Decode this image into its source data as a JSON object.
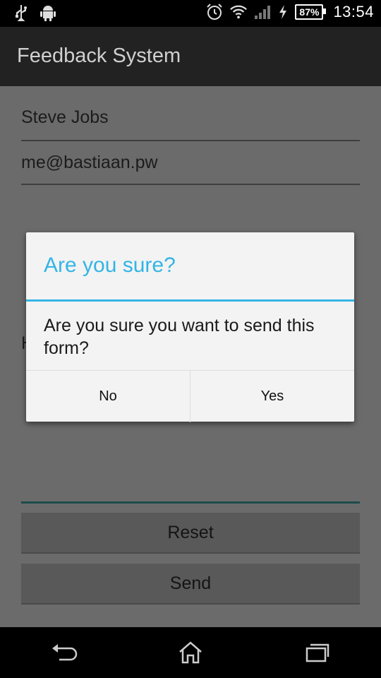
{
  "status_bar": {
    "icons": [
      "usb-icon",
      "android-icon",
      "alarm-icon",
      "wifi-icon",
      "signal-icon",
      "charging-icon",
      "battery-icon"
    ],
    "battery": "87%",
    "time": "13:54"
  },
  "app": {
    "title": "Feedback System"
  },
  "form": {
    "name_value": "Steve Jobs",
    "email_value": "me@bastiaan.pw",
    "partial_hint": "H",
    "reset_label": "Reset",
    "send_label": "Send"
  },
  "dialog": {
    "title": "Are you sure?",
    "message": "Are you sure you want to send this form?",
    "no_label": "No",
    "yes_label": "Yes"
  },
  "nav": {
    "icons": [
      "back-icon",
      "home-icon",
      "recent-apps-icon"
    ]
  },
  "colors": {
    "accent": "#33b5e5",
    "action_bar": "#222222",
    "dim_background": "#6b6b6b"
  }
}
